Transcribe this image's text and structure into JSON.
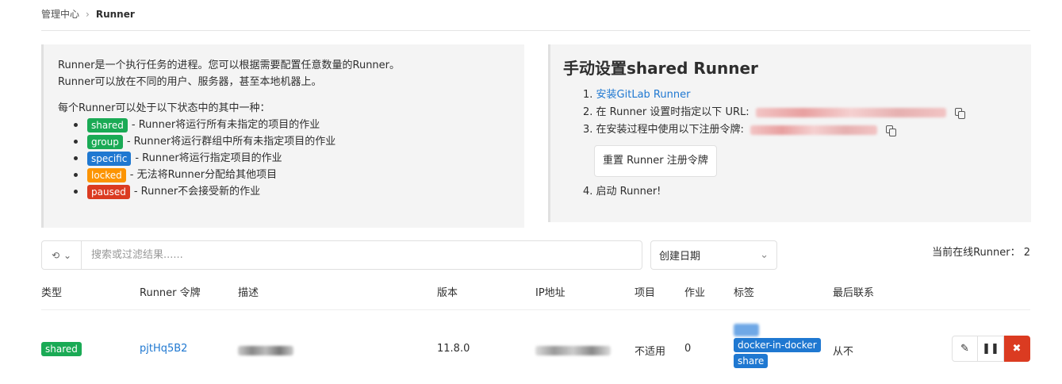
{
  "breadcrumb": {
    "parent": "管理中心",
    "current": "Runner"
  },
  "info": {
    "line1": "Runner是一个执行任务的进程。您可以根据需要配置任意数量的Runner。",
    "line2": "Runner可以放在不同的用户、服务器，甚至本地机器上。",
    "states_intro": "每个Runner可以处于以下状态中的其中一种：",
    "states": [
      {
        "badge": "shared",
        "color": "#1aaa55",
        "text": "- Runner将运行所有未指定的项目的作业"
      },
      {
        "badge": "group",
        "color": "#1aaa55",
        "text": "- Runner将运行群组中所有未指定项目的作业"
      },
      {
        "badge": "specific",
        "color": "#1f78d1",
        "text": "- Runner将运行指定项目的作业"
      },
      {
        "badge": "locked",
        "color": "#fc9403",
        "text": "- 无法将Runner分配给其他项目"
      },
      {
        "badge": "paused",
        "color": "#db3b21",
        "text": "- Runner不会接受新的作业"
      }
    ]
  },
  "setup": {
    "title": "手动设置shared Runner",
    "step1_num": "1.",
    "step1_link": "安装GitLab Runner",
    "step2": "2. 在 Runner 设置时指定以下 URL:",
    "step3": "3. 在安装过程中使用以下注册令牌:",
    "reset_button": "重置 Runner 注册令牌",
    "step4": "4. 启动 Runner!"
  },
  "filter": {
    "placeholder": "搜索或过滤结果......",
    "sort": "创建日期",
    "online_label": "当前在线Runner：",
    "online_count": "2"
  },
  "table": {
    "headers": [
      "类型",
      "Runner 令牌",
      "描述",
      "版本",
      "IP地址",
      "项目",
      "作业",
      "标签",
      "最后联系"
    ],
    "row": {
      "type": "shared",
      "token": "pjtHq5B2",
      "version": "11.8.0",
      "projects": "不适用",
      "jobs": "0",
      "tags": [
        "docker-in-docker",
        "share"
      ],
      "last_contact": "从不"
    }
  },
  "colors": {
    "green": "#1aaa55",
    "blue": "#1f78d1",
    "red": "#db3b21"
  }
}
